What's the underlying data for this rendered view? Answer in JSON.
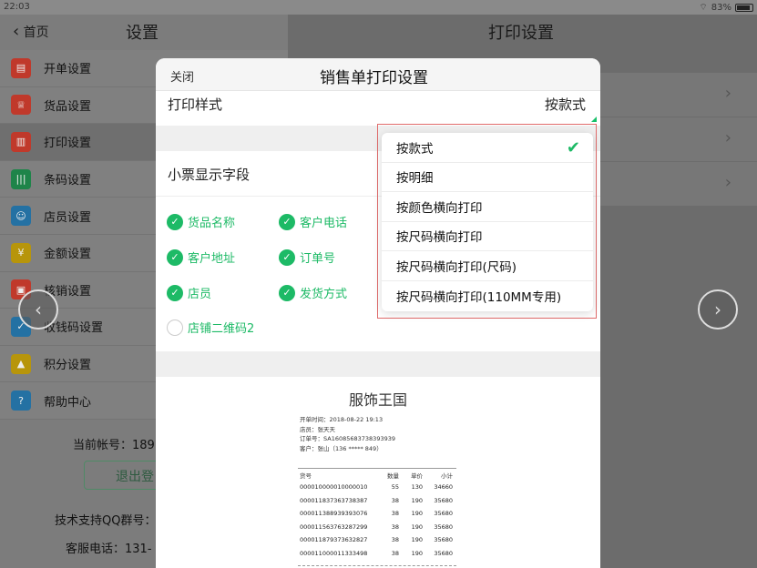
{
  "status": {
    "time": "22:03",
    "battery": "83%"
  },
  "left": {
    "back_label": "首页",
    "title": "设置",
    "menu": [
      {
        "label": "开单设置",
        "color": "#c0392b",
        "icon": "clipboard-icon"
      },
      {
        "label": "货品设置",
        "color": "#c0392b",
        "icon": "shirt-icon"
      },
      {
        "label": "打印设置",
        "color": "#c0392b",
        "icon": "printer-icon"
      },
      {
        "label": "条码设置",
        "color": "#1e8449",
        "icon": "barcode-icon"
      },
      {
        "label": "店员设置",
        "color": "#2471a3",
        "icon": "staff-icon"
      },
      {
        "label": "金额设置",
        "color": "#b7950b",
        "icon": "money-icon"
      },
      {
        "label": "核销设置",
        "color": "#c0392b",
        "icon": "verify-icon"
      },
      {
        "label": "收钱码设置",
        "color": "#2471a3",
        "icon": "qrpay-icon"
      },
      {
        "label": "积分设置",
        "color": "#b7950b",
        "icon": "points-icon"
      },
      {
        "label": "帮助中心",
        "color": "#2471a3",
        "icon": "help-icon"
      }
    ],
    "account": "当前帐号：189",
    "logout": "退出登",
    "qq": "技术支持QQ群号：",
    "phone": "客服电话：131-"
  },
  "right": {
    "title": "打印设置"
  },
  "modal": {
    "close": "关闭",
    "title": "销售单打印设置",
    "style_label": "打印样式",
    "style_value": "按款式",
    "fields_title": "小票显示字段",
    "fields": [
      {
        "label": "货品名称",
        "checked": true
      },
      {
        "label": "客户电话",
        "checked": true
      },
      {
        "label": "客户地址",
        "checked": true
      },
      {
        "label": "订单号",
        "checked": true
      },
      {
        "label": "店员",
        "checked": true
      },
      {
        "label": "发货方式",
        "checked": true
      },
      {
        "label": "店铺二维码2",
        "checked": false
      }
    ],
    "preview": {
      "shop": "服饰王国",
      "meta": [
        "开单时间：2018-08-22 19:13",
        "店员：张天天",
        "订单号：SA1608568373839393​9",
        "客户：张山（136 ***** 849）"
      ],
      "headers": [
        "货号",
        "数量",
        "单价",
        "小计"
      ],
      "rows": [
        [
          "000010000010000010",
          "55",
          "130",
          "34660"
        ],
        [
          "000011837363738387",
          "38",
          "190",
          "35680"
        ],
        [
          "000011388939393076",
          "38",
          "190",
          "35680"
        ],
        [
          "000011563763287299",
          "38",
          "190",
          "35680"
        ],
        [
          "000011879373632827",
          "38",
          "190",
          "35680"
        ],
        [
          "000011000011333498",
          "38",
          "190",
          "35680"
        ]
      ]
    }
  },
  "dropdown": {
    "options": [
      "按款式",
      "按明细",
      "按颜色横向打印",
      "按尺码横向打印",
      "按尺码横向打印(尺码)",
      "按尺码横向打印(110MM专用)"
    ],
    "selected": "按款式"
  }
}
